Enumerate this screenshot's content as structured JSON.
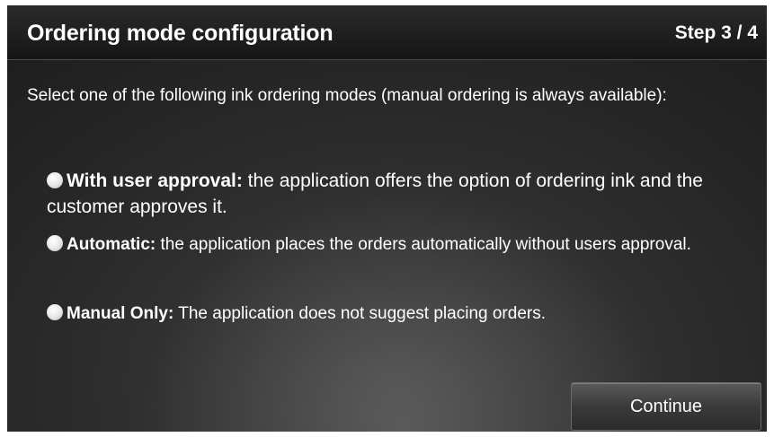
{
  "header": {
    "title": "Ordering mode configuration",
    "step": "Step 3 / 4"
  },
  "intro": "Select one of the following ink ordering modes (manual ordering is always available):",
  "options": [
    {
      "label": "With user approval:",
      "description": " the application offers the option of ordering ink and the customer approves it."
    },
    {
      "label": "Automatic:",
      "description": " the application places the orders automatically without users approval."
    },
    {
      "label": "Manual Only:",
      "description": " The application does not suggest placing orders."
    }
  ],
  "continue_label": "Continue"
}
